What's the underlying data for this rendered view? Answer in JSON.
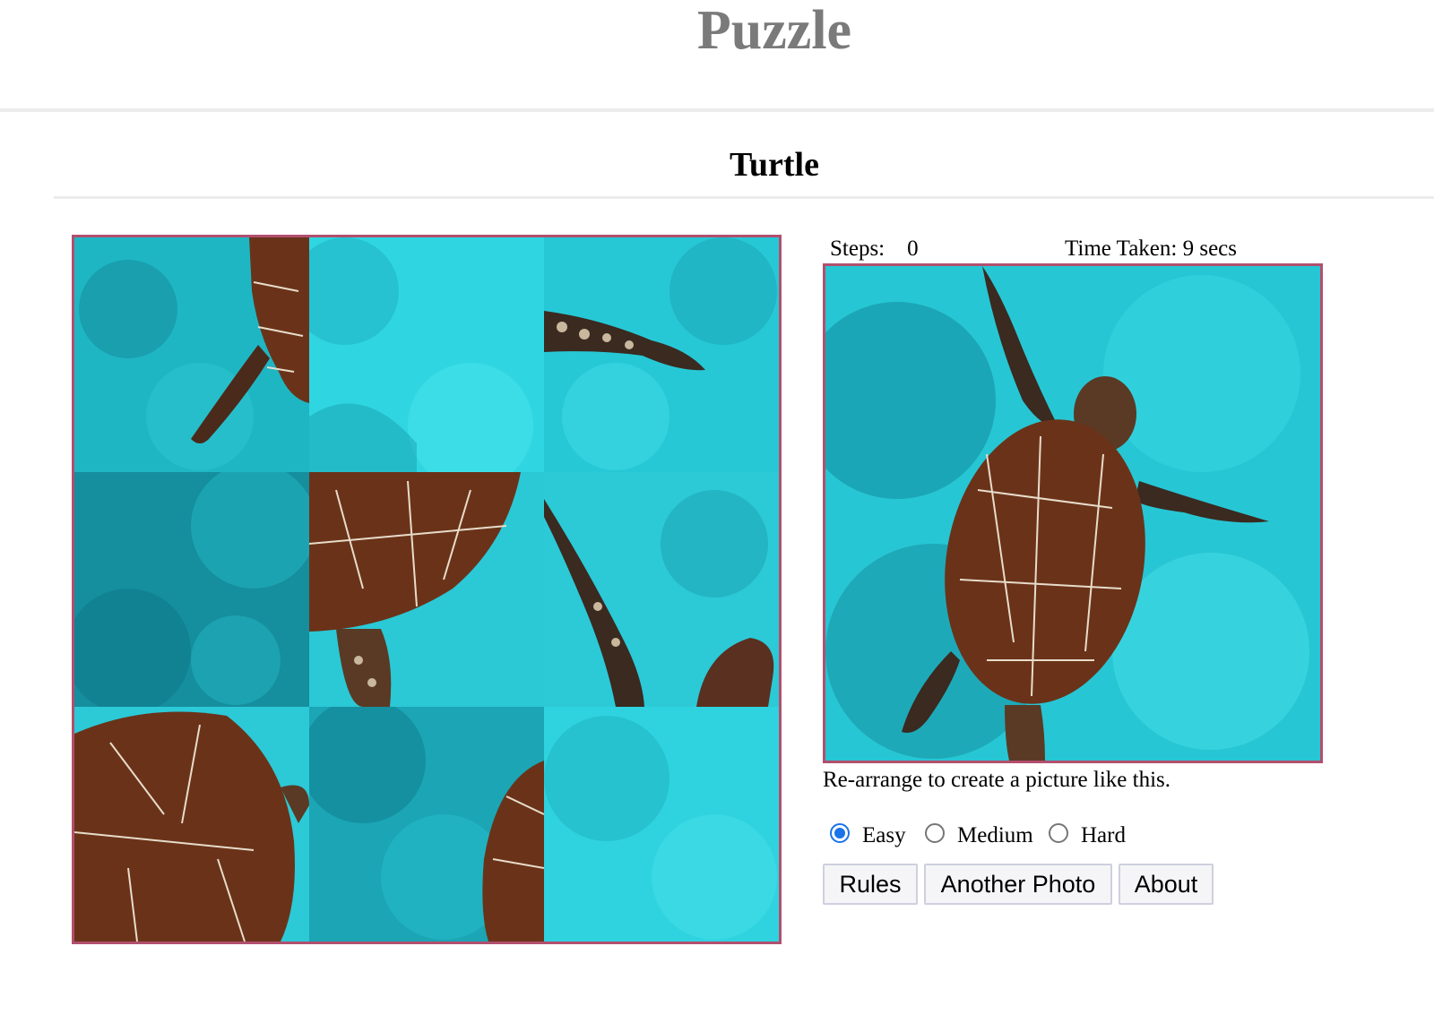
{
  "header": {
    "site_title": "Puzzle"
  },
  "puzzle": {
    "name": "Turtle",
    "grid_size": 3,
    "tiles": [
      {
        "id": "tile-1",
        "contents": "left-rear-flipper-and-shell-edge"
      },
      {
        "id": "tile-2",
        "contents": "empty-water"
      },
      {
        "id": "tile-3",
        "contents": "right-front-flipper-tip"
      },
      {
        "id": "tile-4",
        "contents": "dark-water"
      },
      {
        "id": "tile-5",
        "contents": "shell-lower-and-rear-flipper"
      },
      {
        "id": "tile-6",
        "contents": "left-front-flipper-and-head"
      },
      {
        "id": "tile-7",
        "contents": "shell-left-side"
      },
      {
        "id": "tile-8",
        "contents": "shell-right-edge"
      },
      {
        "id": "tile-9",
        "contents": "empty-water"
      }
    ]
  },
  "stats": {
    "steps_label": "Steps:",
    "steps_value": "0",
    "time_label": "Time Taken:",
    "time_value": "9 secs"
  },
  "reference": {
    "instruction": "Re-arrange to create a picture like this."
  },
  "difficulty": {
    "options": [
      {
        "label": "Easy",
        "checked": true
      },
      {
        "label": "Medium",
        "checked": false
      },
      {
        "label": "Hard",
        "checked": false
      }
    ]
  },
  "buttons": {
    "rules": "Rules",
    "another_photo": "Another Photo",
    "about": "About"
  },
  "colors": {
    "border": "#b24f6e",
    "water_light": "#2fd6e2",
    "water_dark": "#148a9c",
    "shell": "#6a3319",
    "radio_checked": "#1a73e8"
  }
}
